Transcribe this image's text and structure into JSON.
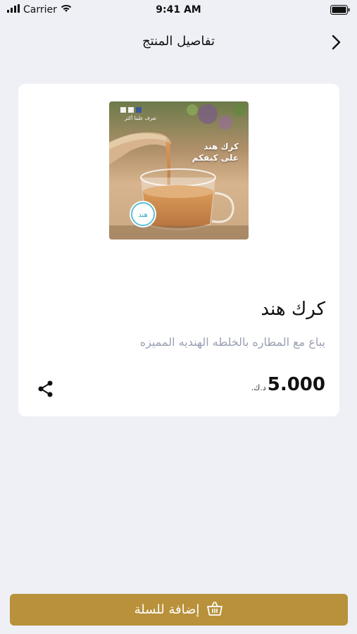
{
  "status_bar": {
    "carrier": "Carrier",
    "time": "9:41 AM"
  },
  "header": {
    "title": "تفاصيل المنتج"
  },
  "product": {
    "image_overlay_title": "كرك هند",
    "image_overlay_subtitle": "على كيفكم",
    "image_overlay_small": "تعرف علينا أكثر",
    "name": "كرك هند",
    "description": "يباع مع المطاره بالخلطه الهنديه المميزه",
    "price": "5.000",
    "currency": "د.ك."
  },
  "footer": {
    "add_to_cart_label": "إضافة للسلة"
  },
  "colors": {
    "background": "#eef0f6",
    "accent": "#b8913a",
    "description_text": "#9aa0b2"
  }
}
